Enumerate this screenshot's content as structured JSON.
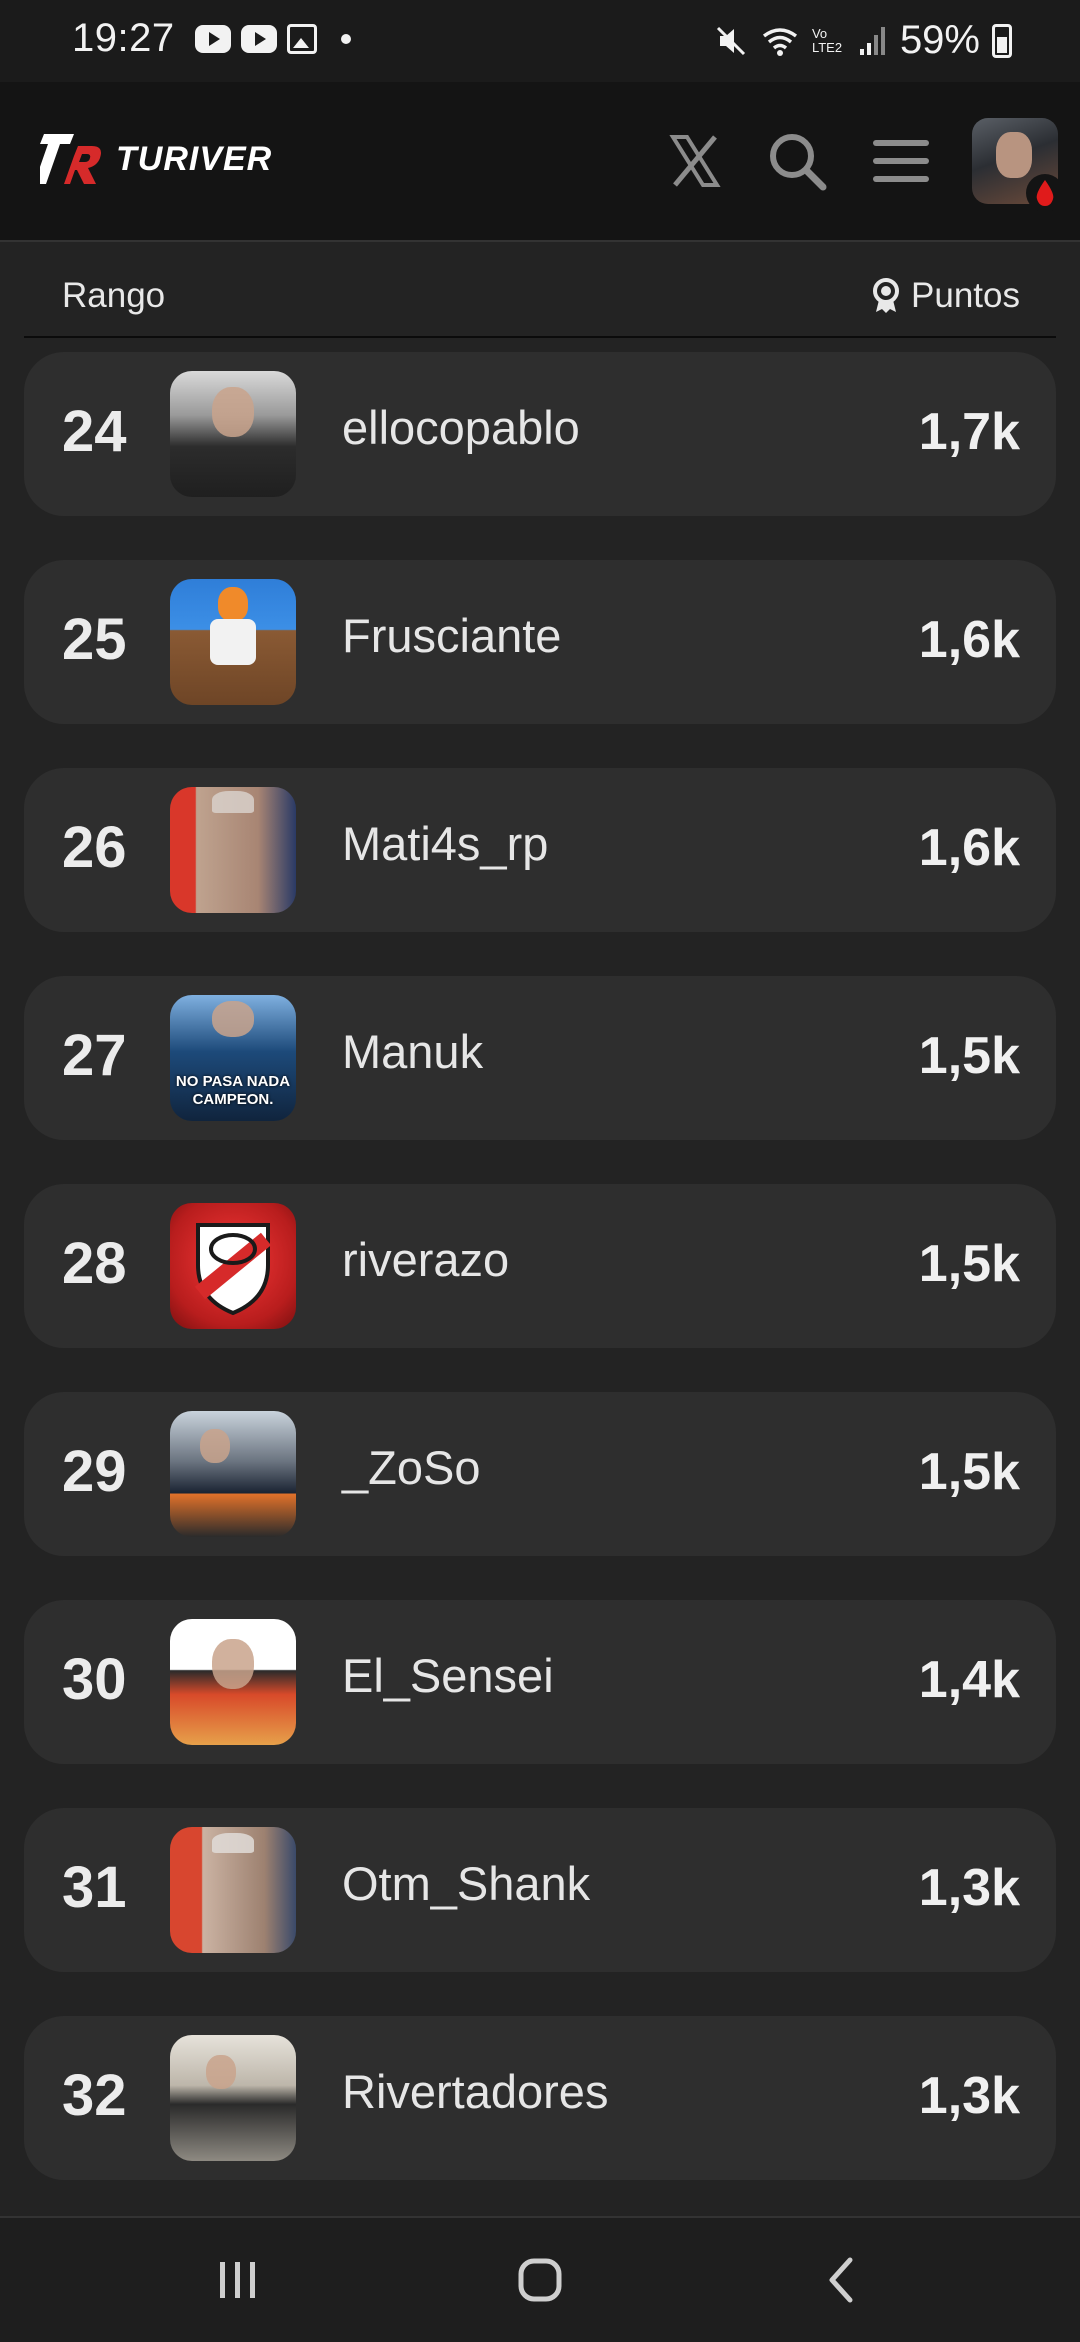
{
  "status_bar": {
    "time": "19:27",
    "battery": "59%",
    "left_icons": [
      "youtube-icon",
      "youtube-icon",
      "gallery-icon",
      "notification-dot"
    ],
    "right_icons": [
      "mute-icon",
      "wifi-icon",
      "volte-icon",
      "signal-icon",
      "battery-icon"
    ],
    "volte_label": "Vo LTE2"
  },
  "header": {
    "logo_text": "TURIVER",
    "brand_color": "#d62a2a",
    "icons": [
      "x-logo-icon",
      "search-icon",
      "menu-icon"
    ]
  },
  "table": {
    "rank_header": "Rango",
    "points_header": "Puntos",
    "rows": [
      {
        "rank": "24",
        "username": "ellocopablo",
        "points": "1,7k"
      },
      {
        "rank": "25",
        "username": "Frusciante",
        "points": "1,6k"
      },
      {
        "rank": "26",
        "username": "Mati4s_rp",
        "points": "1,6k"
      },
      {
        "rank": "27",
        "username": "Manuk",
        "points": "1,5k",
        "avatar_caption": "NO PASA NADA CAMPEON."
      },
      {
        "rank": "28",
        "username": "riverazo",
        "points": "1,5k"
      },
      {
        "rank": "29",
        "username": "_ZoSo",
        "points": "1,5k"
      },
      {
        "rank": "30",
        "username": "El_Sensei",
        "points": "1,4k"
      },
      {
        "rank": "31",
        "username": "Otm_Shank",
        "points": "1,3k"
      },
      {
        "rank": "32",
        "username": "Rivertadores",
        "points": "1,3k"
      }
    ]
  },
  "nav_bar": {
    "buttons": [
      "recents-icon",
      "home-icon",
      "back-icon"
    ]
  }
}
